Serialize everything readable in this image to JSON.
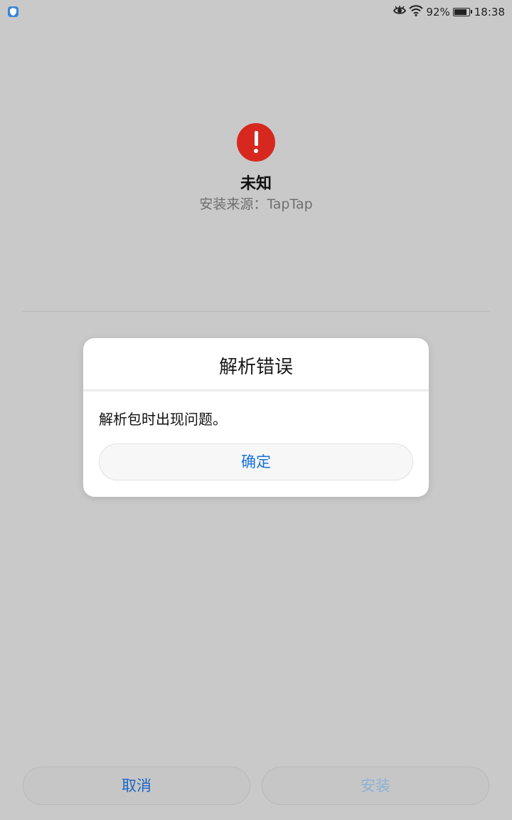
{
  "status_bar": {
    "battery_percent": "92%",
    "battery_level": 0.92,
    "time": "18:38",
    "icons": [
      "shield-icon",
      "eye-icon",
      "wifi-icon",
      "battery-icon"
    ]
  },
  "app": {
    "icon": "alert-icon",
    "icon_color": "#d7281f",
    "name": "未知",
    "source": "安装来源：TapTap"
  },
  "dialog": {
    "title": "解析错误",
    "message": "解析包时出现问题。",
    "ok_label": "确定"
  },
  "bottom_buttons": {
    "cancel_label": "取消",
    "install_label": "安装"
  },
  "colors": {
    "background": "#c9c9c9",
    "accent": "#1a73d9",
    "error": "#d7281f"
  }
}
